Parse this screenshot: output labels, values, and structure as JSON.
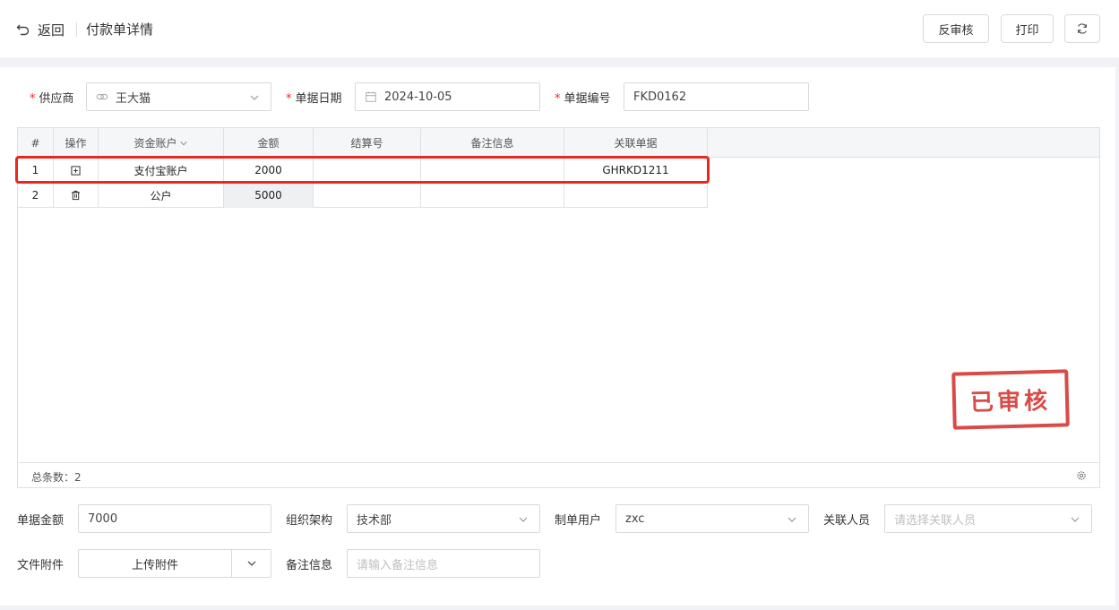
{
  "header": {
    "back_label": "返回",
    "title": "付款单详情",
    "buttons": {
      "unapprove": "反审核",
      "print": "打印"
    }
  },
  "form": {
    "supplier": {
      "label": "供应商",
      "value": "王大猫"
    },
    "doc_date": {
      "label": "单据日期",
      "value": "2024-10-05"
    },
    "doc_no": {
      "label": "单据编号",
      "value": "FKD0162"
    }
  },
  "table": {
    "columns": [
      "#",
      "操作",
      "资金账户",
      "金额",
      "结算号",
      "备注信息",
      "关联单据"
    ],
    "rows": [
      {
        "index": "1",
        "account": "支付宝账户",
        "amount": "2000",
        "settle_no": "",
        "remark": "",
        "related_doc": "GHRKD1211"
      },
      {
        "index": "2",
        "account": "公户",
        "amount": "5000",
        "settle_no": "",
        "remark": "",
        "related_doc": ""
      }
    ],
    "total_label": "总条数：",
    "total_count": "2"
  },
  "stamp": {
    "text": "已审核"
  },
  "bottom_form": {
    "amount": {
      "label": "单据金额",
      "value": "7000"
    },
    "org": {
      "label": "组织架构",
      "value": "技术部"
    },
    "creator": {
      "label": "制单用户",
      "value": "zxc"
    },
    "related_person": {
      "label": "关联人员",
      "placeholder": "请选择关联人员"
    },
    "attachment": {
      "label": "文件附件",
      "button": "上传附件"
    },
    "remark": {
      "label": "备注信息",
      "placeholder": "请输入备注信息"
    }
  },
  "colors": {
    "required": "#f5222d",
    "stamp": "#d63c38",
    "highlight": "#e8281e",
    "band": "#f0f2f5"
  }
}
